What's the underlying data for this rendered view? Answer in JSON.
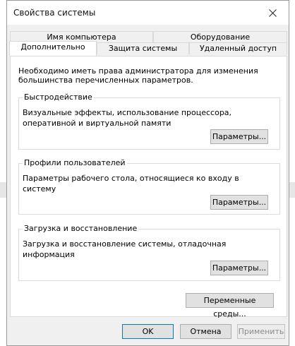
{
  "window": {
    "title": "Свойства системы"
  },
  "tabs": {
    "row1": [
      {
        "label": "Имя компьютера"
      },
      {
        "label": "Оборудование"
      }
    ],
    "row2": [
      {
        "label": "Дополнительно",
        "active": true
      },
      {
        "label": "Защита системы"
      },
      {
        "label": "Удаленный доступ"
      }
    ]
  },
  "panel": {
    "notice": "Необходимо иметь права администратора для изменения большинства перечисленных параметров.",
    "performance": {
      "title": "Быстродействие",
      "description": "Визуальные эффекты, использование процессора, оперативной и виртуальной памяти",
      "button": "Параметры..."
    },
    "profiles": {
      "title": "Профили пользователей",
      "description": "Параметры рабочего стола, относящиеся ко входу в систему",
      "button": "Параметры..."
    },
    "startup": {
      "title": "Загрузка и восстановление",
      "description": "Загрузка и восстановление системы, отладочная информация",
      "button": "Параметры..."
    },
    "env_button": "Переменные среды..."
  },
  "footer": {
    "ok": "OK",
    "cancel": "Отмена",
    "apply": "Применить"
  },
  "colors": {
    "accent": "#0078d7",
    "panel_bg": "#ffffff",
    "window_bg": "#f0f0f0",
    "button_bg": "#e1e1e1"
  }
}
